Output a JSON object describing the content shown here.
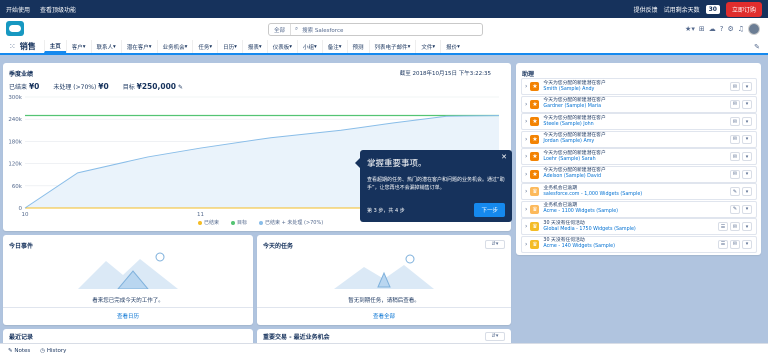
{
  "topbar": {
    "getting_started": "开始使用",
    "view_top_features": "查看顶级功能",
    "feedback": "提供反馈",
    "trial_label": "试用剩余天数",
    "trial_days": "30",
    "buy": "立即订购"
  },
  "search": {
    "scope": "全部",
    "placeholder": "搜索 Salesforce"
  },
  "nav": {
    "app": "销售",
    "tabs": [
      "主页",
      "客户",
      "联系人",
      "潜在客户",
      "业务机会",
      "任务",
      "日历",
      "报表",
      "仪表板",
      "小组",
      "备注",
      "预测",
      "列表电子邮件",
      "文件",
      "报价"
    ]
  },
  "quarterly": {
    "title": "季度业绩",
    "as_of": "截至 2018年10月15日 下午3:22:35",
    "closed_label": "已结束",
    "closed_value": "¥0",
    "open_label": "未处理 (>70%)",
    "open_value": "¥0",
    "goal_label": "目标",
    "goal_value": "¥250,000"
  },
  "chart_data": {
    "type": "line",
    "x_ticks": [
      "10",
      "11",
      "12"
    ],
    "y_ticks": [
      "0",
      "60k",
      "120k",
      "180k",
      "240k",
      "300k"
    ],
    "ylim": [
      0,
      300000
    ],
    "series": [
      {
        "name": "已结束",
        "color": "#f4bc25",
        "x": [
          10,
          12.7
        ],
        "y": [
          0,
          0
        ]
      },
      {
        "name": "目标",
        "color": "#54c473",
        "x": [
          10,
          12.7
        ],
        "y": [
          250000,
          250000
        ]
      },
      {
        "name": "已结束 + 未处理 (>70%)",
        "color": "#89bde8",
        "x": [
          10,
          10.3,
          10.7,
          11,
          11.4,
          11.8,
          12.1,
          12.4,
          12.7
        ],
        "y": [
          0,
          95000,
          138000,
          162000,
          190000,
          210000,
          230000,
          248000,
          250000
        ]
      }
    ]
  },
  "popup": {
    "title": "掌握重要事项。",
    "body": "查看超期的任务、热门的潜在客户和问题的业务机会。通过“助手”，让您再也不会漏掉销售订单。",
    "step": "第 3 步，共 4 步",
    "next": "下一步"
  },
  "assistant": {
    "title": "助理",
    "items": [
      {
        "t": "今天为您分配的新建潜在客户",
        "l": "Smith (Sample) Andy",
        "k": "lead"
      },
      {
        "t": "今天为您分配的新建潜在客户",
        "l": "Gardner (Sample) Maria",
        "k": "lead"
      },
      {
        "t": "今天为您分配的新建潜在客户",
        "l": "Steele (Sample) John",
        "k": "lead"
      },
      {
        "t": "今天为您分配的新建潜在客户",
        "l": "Jordan (Sample) Amy",
        "k": "lead"
      },
      {
        "t": "今天为您分配的新建潜在客户",
        "l": "Loehr (Sample) Sarah",
        "k": "lead"
      },
      {
        "t": "今天为您分配的新建潜在客户",
        "l": "Adelson (Sample) David",
        "k": "lead"
      },
      {
        "t": "业务机会已逾期",
        "l": "salesforce.com - 1,000 Widgets (Sample)",
        "k": "opp"
      },
      {
        "t": "业务机会已逾期",
        "l": "Acme - 1100 Widgets (Sample)",
        "k": "opp"
      },
      {
        "t": "30 天没有任何活动",
        "l": "Global Media - 1750 Widgets (Sample)",
        "k": "idle"
      },
      {
        "t": "30 天没有任何活动",
        "l": "Acme - 140 Widgets (Sample)",
        "k": "idle"
      }
    ]
  },
  "today_events": {
    "title": "今日事件",
    "empty": "看来您已完成今天的工作了。",
    "link": "查看日历"
  },
  "today_tasks": {
    "title": "今天的任务",
    "empty": "暂无到期任务，请稍后查看。",
    "link": "查看全部"
  },
  "recent": {
    "title": "最近记录"
  },
  "deals": {
    "title": "重要交易 - 最近业务机会"
  },
  "footer": {
    "notes": "Notes",
    "history": "History"
  },
  "colors": {
    "lead": "#f38303",
    "opp": "#fcb95b",
    "idle": "#f4bc25",
    "brand": "#1589ee",
    "navy": "#16325c"
  }
}
